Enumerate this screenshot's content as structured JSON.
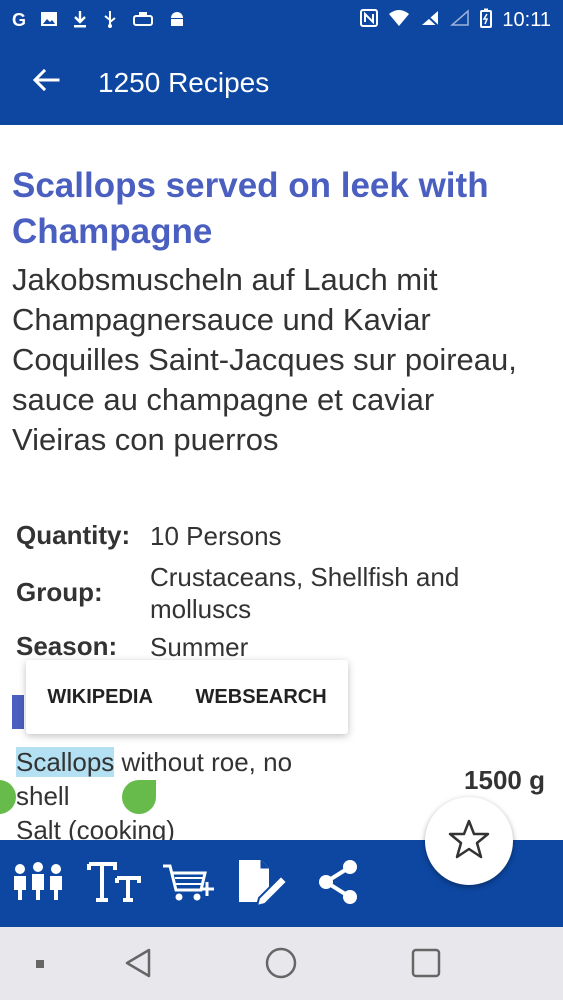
{
  "status_bar": {
    "left_icons": [
      "google-icon",
      "image-icon",
      "download-icon",
      "usb-icon",
      "taxi-icon",
      "android-icon"
    ],
    "right_icons": [
      "nfc-icon",
      "wifi-icon",
      "no-signal-icon",
      "signal-icon",
      "battery-icon"
    ],
    "time": "10:11"
  },
  "app_bar": {
    "title": "1250 Recipes"
  },
  "recipe": {
    "title": "Scallops served on leek with Champagne",
    "alt_names": "Jakobsmuscheln auf Lauch mit Champagnersauce und Kaviar\nCoquilles Saint-Jacques sur poireau, sauce au champagne et caviar\nVieiras con puerros",
    "meta": {
      "quantity_label": "Quantity:",
      "quantity_value": "10 Persons",
      "group_label": "Group:",
      "group_value": "Crustaceans, Shellfish and molluscs",
      "season_label": "Season:",
      "season_value": "Summer"
    },
    "ingredients": {
      "first_selected": "Scallops",
      "first_rest": " without roe, no shell",
      "first_qty": "1500 g",
      "next": "Salt (cooking)"
    }
  },
  "popup_menu": {
    "items": [
      "WIKIPEDIA",
      "WEBSEARCH"
    ]
  },
  "toolbar": {
    "icons": [
      "persons-icon",
      "text-size-icon",
      "add-to-cart-icon",
      "edit-note-icon",
      "share-icon"
    ],
    "fab_icon": "star-icon"
  },
  "colors": {
    "primary": "#0d47a1",
    "title": "#4a5fbf",
    "selection": "#b3e0f2",
    "handle": "#66bb4a"
  }
}
